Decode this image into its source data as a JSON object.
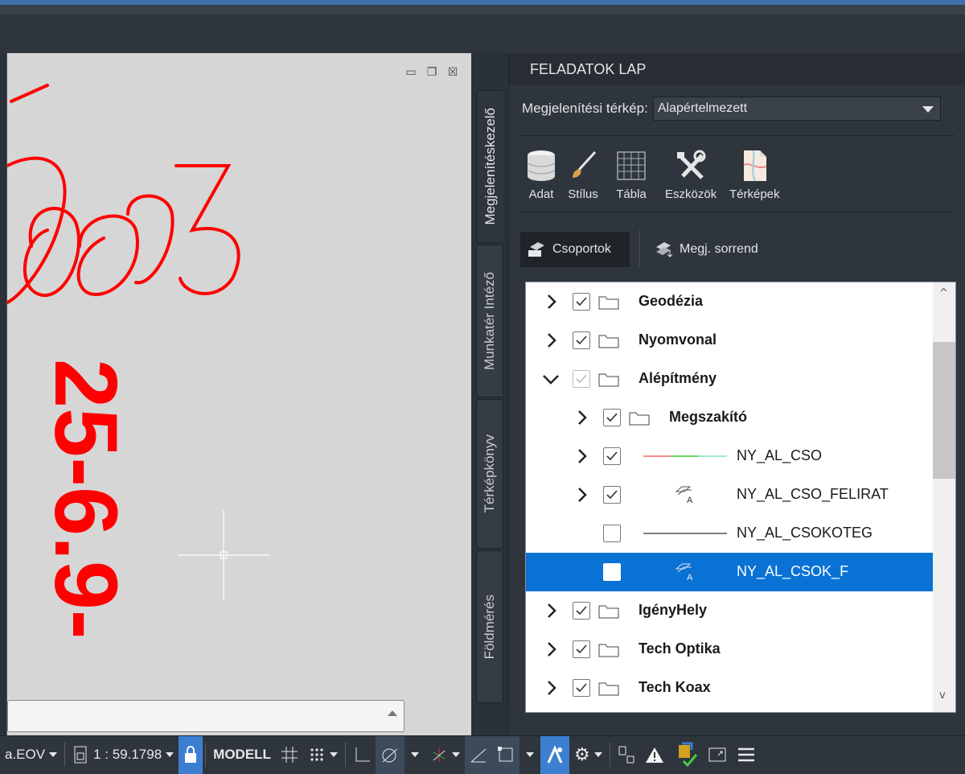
{
  "viewport": {
    "drawing_text_1": "003",
    "drawing_text_2": "25-6.9-",
    "controls": [
      "minimize-icon",
      "restore-icon",
      "close-icon"
    ]
  },
  "side_tabs": [
    {
      "label": "Megjelenítéskezelő",
      "active": true
    },
    {
      "label": "Munkatér Intéző",
      "active": false
    },
    {
      "label": "Térképkönyv",
      "active": false
    },
    {
      "label": "Földmérés",
      "active": false
    }
  ],
  "pane": {
    "title": "FELADATOK LAP",
    "map_label": "Megjelenítési térkép:",
    "map_value": "Alapértelmezett",
    "tools": [
      {
        "label": "Adat",
        "icon": "database-icon"
      },
      {
        "label": "Stílus",
        "icon": "brush-icon"
      },
      {
        "label": "Tábla",
        "icon": "table-icon"
      },
      {
        "label": "Eszközök",
        "icon": "tools-icon"
      },
      {
        "label": "Térképek",
        "icon": "maps-icon"
      }
    ],
    "views": [
      {
        "label": "Csoportok",
        "active": true
      },
      {
        "label": "Megj. sorrend",
        "active": false
      }
    ]
  },
  "layers": [
    {
      "name": "Geodézia",
      "level": 0,
      "expand": "collapsed",
      "checked": true,
      "kind": "group"
    },
    {
      "name": "Nyomvonal",
      "level": 0,
      "expand": "collapsed",
      "checked": true,
      "kind": "group"
    },
    {
      "name": "Alépítmény",
      "level": 0,
      "expand": "expanded",
      "checked": "partial",
      "kind": "group"
    },
    {
      "name": "Megszakító",
      "level": 1,
      "expand": "collapsed",
      "checked": true,
      "kind": "group"
    },
    {
      "name": "NY_AL_CSO",
      "level": 1,
      "expand": "collapsed",
      "checked": true,
      "kind": "line-multicolor"
    },
    {
      "name": "NY_AL_CSO_FELIRAT",
      "level": 1,
      "expand": "collapsed",
      "checked": true,
      "kind": "label"
    },
    {
      "name": "NY_AL_CSOKOTEG",
      "level": 1,
      "expand": "none",
      "checked": false,
      "kind": "line"
    },
    {
      "name": "NY_AL_CSOK_F",
      "level": 1,
      "expand": "none",
      "checked": false,
      "kind": "label",
      "selected": true
    },
    {
      "name": "IgényHely",
      "level": 0,
      "expand": "collapsed",
      "checked": true,
      "kind": "group"
    },
    {
      "name": "Tech Optika",
      "level": 0,
      "expand": "collapsed",
      "checked": true,
      "kind": "group"
    },
    {
      "name": "Tech Koax",
      "level": 0,
      "expand": "collapsed",
      "checked": true,
      "kind": "group"
    }
  ],
  "status": {
    "coord_system": "a.EOV",
    "scale": "1 : 59.1798",
    "space": "MODELL"
  },
  "colors": {
    "selection": "#0a72d4",
    "drawing_red": "#ff0000"
  }
}
